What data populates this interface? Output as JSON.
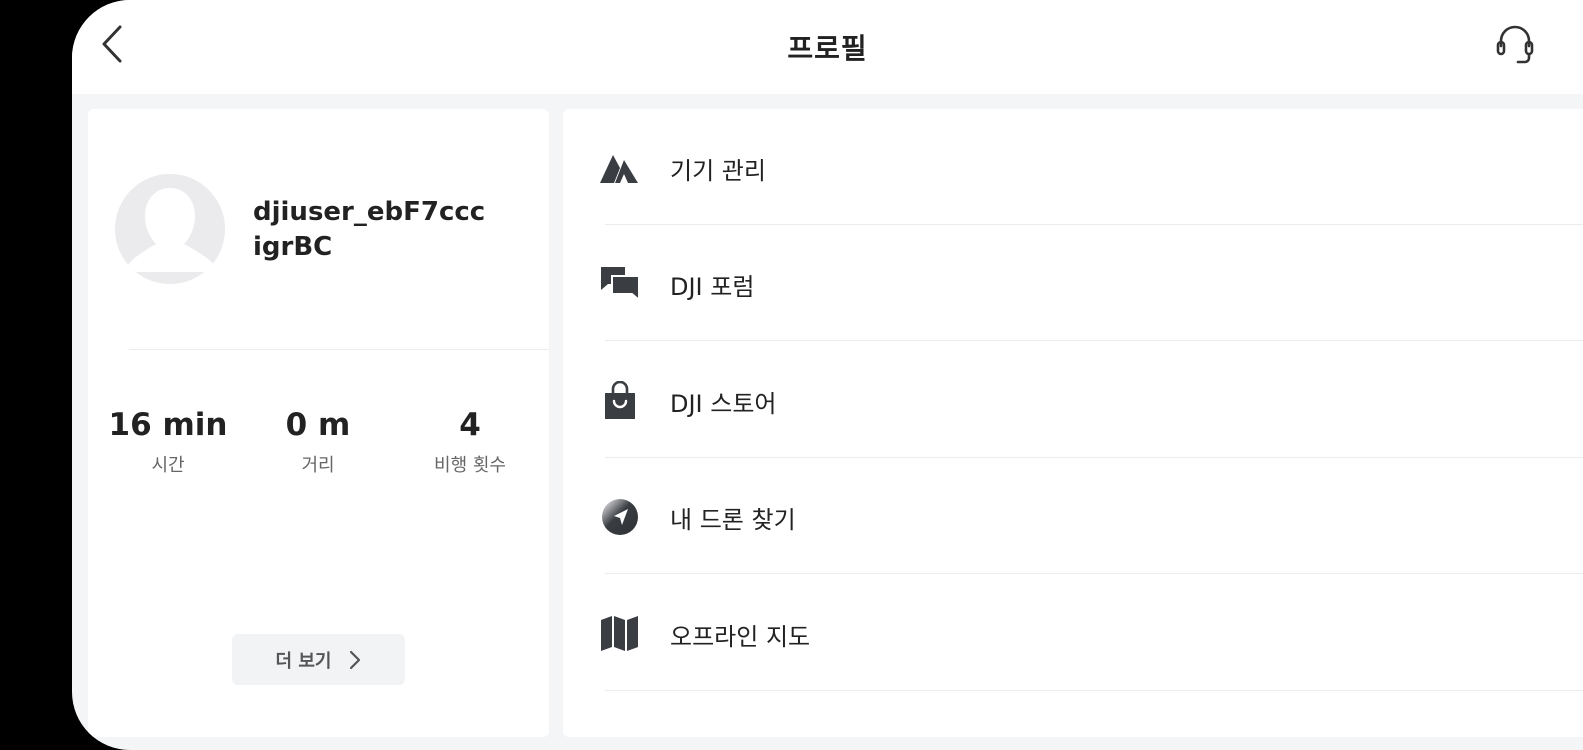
{
  "header": {
    "title": "프로필"
  },
  "profile": {
    "username": "djiuser_ebF7cccigrBC"
  },
  "stats": [
    {
      "value": "16 min",
      "label": "시간"
    },
    {
      "value": "0 m",
      "label": "거리"
    },
    {
      "value": "4",
      "label": "비행 횟수"
    }
  ],
  "more_button": {
    "label": "더 보기"
  },
  "menu": [
    {
      "label": "기기 관리",
      "icon": "device-icon"
    },
    {
      "label": "DJI 포럼",
      "icon": "forum-icon"
    },
    {
      "label": "DJI 스토어",
      "icon": "store-bag-icon"
    },
    {
      "label": "내 드론 찾기",
      "icon": "compass-icon"
    },
    {
      "label": "오프라인 지도",
      "icon": "map-icon"
    }
  ],
  "colors": {
    "background": "#f4f5f7",
    "card": "#ffffff",
    "icon": "#3a3d42",
    "text": "#222222"
  }
}
